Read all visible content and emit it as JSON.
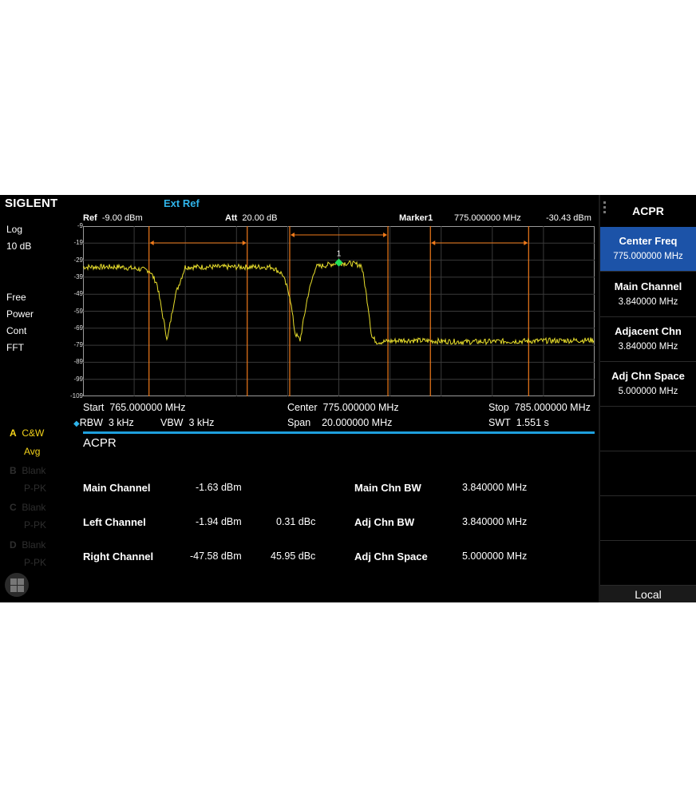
{
  "header": {
    "brand": "SIGLENT",
    "ext_ref": "Ext Ref",
    "ref_label": "Ref",
    "ref_value": "-9.00 dBm",
    "att_label": "Att",
    "att_value": "20.00 dB",
    "marker_label": "Marker1",
    "marker_freq": "775.000000 MHz",
    "marker_amp": "-30.43 dBm"
  },
  "left_panel": {
    "scale_type": "Log",
    "scale_div": "10 dB",
    "trigger": "Free",
    "sweep_mode": "Power",
    "sweep_cont": "Cont",
    "sweep_type": "FFT",
    "traces": [
      {
        "letter": "A",
        "mode": "C&W",
        "detector": "Avg"
      },
      {
        "letter": "B",
        "mode": "Blank",
        "detector": "P-PK"
      },
      {
        "letter": "C",
        "mode": "Blank",
        "detector": "P-PK"
      },
      {
        "letter": "D",
        "mode": "Blank",
        "detector": "P-PK"
      }
    ]
  },
  "chart_data": {
    "type": "line",
    "xlabel": "",
    "ylabel": "",
    "x_range": [
      765.0,
      785.0
    ],
    "y_range": [
      -109,
      -9
    ],
    "y_ticks": [
      "-9",
      "-19",
      "-29",
      "-39",
      "-49",
      "-59",
      "-69",
      "-79",
      "-89",
      "-99",
      "-109"
    ],
    "grid": true,
    "series": [
      {
        "color": "#e9df2c",
        "x": [
          765.0,
          766.5,
          767.6,
          767.9,
          768.1,
          768.3,
          768.6,
          769.0,
          772.4,
          772.8,
          773.1,
          773.3,
          773.5,
          773.8,
          774.1,
          774.5,
          775.0,
          775.5,
          775.9,
          776.0,
          776.2,
          776.3,
          776.5,
          776.7,
          777.5,
          780.0,
          785.0
        ],
        "values": [
          -33,
          -33,
          -35,
          -43,
          -60,
          -76,
          -50,
          -33,
          -33,
          -37,
          -50,
          -72,
          -76,
          -50,
          -33,
          -32,
          -30.43,
          -31,
          -32,
          -40,
          -60,
          -74,
          -77,
          -77,
          -76,
          -77,
          -76
        ]
      }
    ],
    "bandwidth_markers": [
      {
        "name": "left",
        "x_start": 767.58,
        "x_end": 771.42
      },
      {
        "name": "main",
        "x_start": 773.08,
        "x_end": 776.92
      },
      {
        "name": "right",
        "x_start": 778.58,
        "x_end": 782.42
      }
    ],
    "marker": {
      "label": "1",
      "x": 775.0,
      "y": -30.43,
      "color": "#22e05a"
    }
  },
  "sweep_info": {
    "start_label": "Start",
    "start": "765.000000 MHz",
    "center_label": "Center",
    "center": "775.000000 MHz",
    "stop_label": "Stop",
    "stop": "785.000000 MHz",
    "rbw_label": "RBW",
    "rbw": "3 kHz",
    "vbw_label": "VBW",
    "vbw": "3 kHz",
    "span_label": "Span",
    "span": "20.000000 MHz",
    "swt_label": "SWT",
    "swt": "1.551 s"
  },
  "results": {
    "title": "ACPR",
    "rows": [
      {
        "label": "Main Channel",
        "power": "-1.63 dBm",
        "ratio": ""
      },
      {
        "label": "Left Channel",
        "power": "-1.94 dBm",
        "ratio": "0.31 dBc"
      },
      {
        "label": "Right Channel",
        "power": "-47.58 dBm",
        "ratio": "45.95 dBc"
      }
    ],
    "params": [
      {
        "label": "Main Chn BW",
        "value": "3.840000 MHz"
      },
      {
        "label": "Adj Chn BW",
        "value": "3.840000 MHz"
      },
      {
        "label": "Adj Chn Space",
        "value": "5.000000 MHz"
      }
    ]
  },
  "menu": {
    "title": "ACPR",
    "items": [
      {
        "label": "Center Freq",
        "value": "775.000000 MHz"
      },
      {
        "label": "Main Channel",
        "value": "3.840000 MHz"
      },
      {
        "label": "Adjacent Chn",
        "value": "3.840000 MHz"
      },
      {
        "label": "Adj Chn Space",
        "value": "5.000000 MHz"
      }
    ],
    "local": "Local"
  },
  "colors": {
    "accent": "#1e9fdd",
    "selected_menu": "#1c53a8",
    "trace": "#e9df2c",
    "band_marker": "#f07a1a",
    "marker": "#22e05a"
  }
}
